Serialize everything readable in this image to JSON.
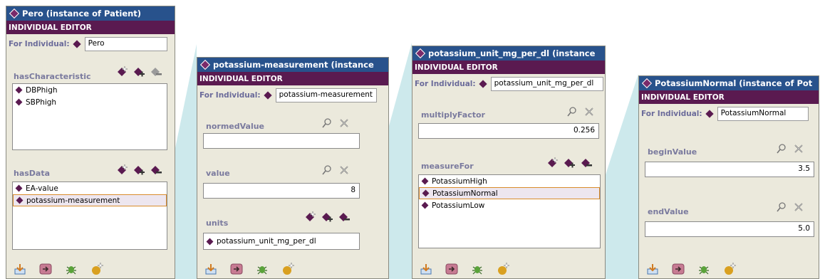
{
  "panels": {
    "pero": {
      "title": "Pero  (instance of Patient)",
      "editor_label": "INDIVIDUAL EDITOR",
      "for_label": "For Individual:",
      "for_value": "Pero",
      "has_characteristic": {
        "label": "hasCharacteristic",
        "items": [
          "DBPhigh",
          "SBPhigh"
        ]
      },
      "has_data": {
        "label": "hasData",
        "items": [
          "EA-value",
          "potassium-measurement"
        ],
        "selected": "potassium-measurement"
      }
    },
    "potassium_measurement": {
      "title": "potassium-measurement  (instance",
      "editor_label": "INDIVIDUAL EDITOR",
      "for_label": "For Individual:",
      "for_value": "potassium-measurement",
      "normed_value": {
        "label": "normedValue",
        "value": ""
      },
      "value": {
        "label": "value",
        "value": "8"
      },
      "units": {
        "label": "units",
        "value": "potassium_unit_mg_per_dl"
      }
    },
    "unit": {
      "title": "potassium_unit_mg_per_dl  (instance",
      "editor_label": "INDIVIDUAL EDITOR",
      "for_label": "For Individual:",
      "for_value": "potassium_unit_mg_per_dl",
      "multiply_factor": {
        "label": "multiplyFactor",
        "value": "0.256"
      },
      "measure_for": {
        "label": "measureFor",
        "items": [
          "PotassiumHigh",
          "PotassiumNormal",
          "PotassiumLow"
        ],
        "selected": "PotassiumNormal"
      }
    },
    "normal": {
      "title": "PotassiumNormal  (instance of Pot",
      "editor_label": "INDIVIDUAL EDITOR",
      "for_label": "For Individual:",
      "for_value": "PotassiumNormal",
      "begin_value": {
        "label": "beginValue",
        "value": "3.5"
      },
      "end_value": {
        "label": "endValue",
        "value": "5.0"
      }
    }
  },
  "icons": {
    "create": "create-instance-icon",
    "add": "add-value-icon",
    "remove": "remove-value-icon",
    "view": "view-icon",
    "delete": "delete-icon",
    "export": "export-icon",
    "go": "go-icon",
    "bug": "debug-icon",
    "ball": "constraint-icon"
  },
  "colors": {
    "title_bar": "#28528c",
    "editor_bar": "#5a1a50",
    "panel_bg": "#ebe9dc",
    "connector": "#bfe3e6",
    "selection_border": "#d98c2a"
  }
}
